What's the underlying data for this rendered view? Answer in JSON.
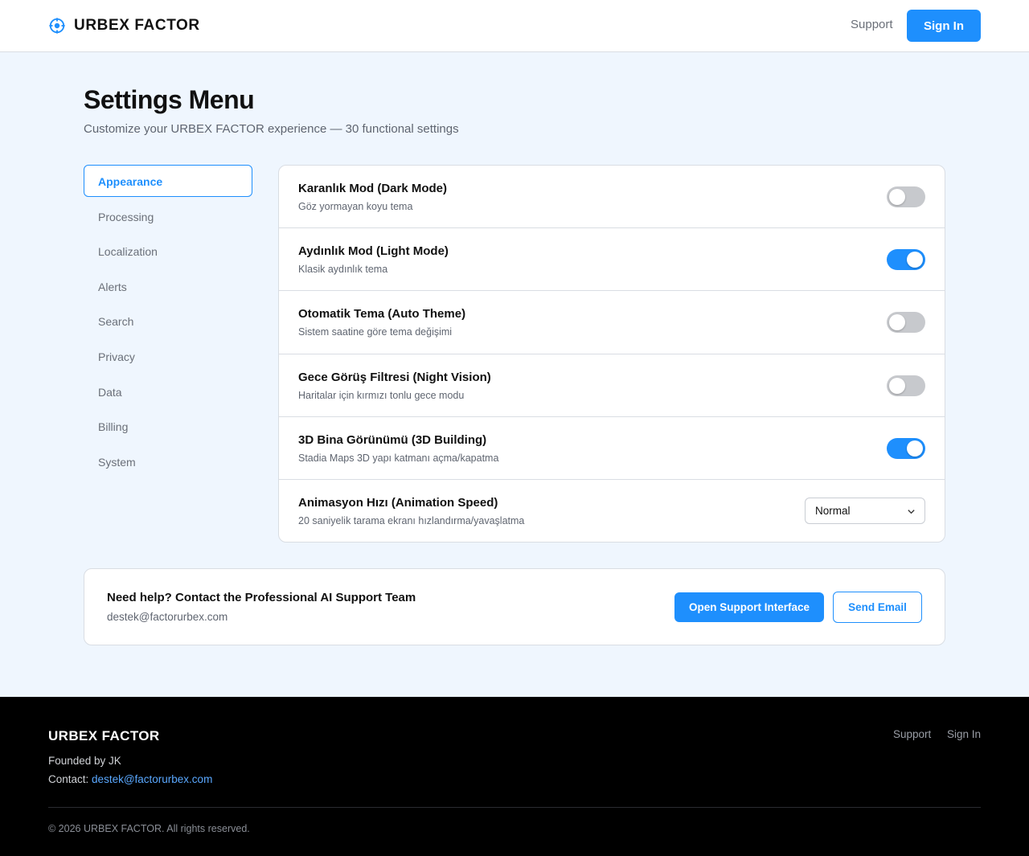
{
  "header": {
    "brand": "URBEX FACTOR",
    "brand_icon": "crosshair-icon",
    "support_link": "Support",
    "signin_label": "Sign In",
    "accent_color": "#1e8ffd"
  },
  "page": {
    "title": "Settings Menu",
    "subtitle": "Customize your URBEX FACTOR experience — 30 functional settings"
  },
  "sidebar": {
    "active": "Appearance",
    "items": [
      {
        "label": "Appearance"
      },
      {
        "label": "Processing"
      },
      {
        "label": "Localization"
      },
      {
        "label": "Alerts"
      },
      {
        "label": "Search"
      },
      {
        "label": "Privacy"
      },
      {
        "label": "Data"
      },
      {
        "label": "Billing"
      },
      {
        "label": "System"
      }
    ]
  },
  "settings": [
    {
      "title": "Karanlık Mod (Dark Mode)",
      "desc": "Göz yormayan koyu tema",
      "control": "toggle",
      "on": false
    },
    {
      "title": "Aydınlık Mod (Light Mode)",
      "desc": "Klasik aydınlık tema",
      "control": "toggle",
      "on": true
    },
    {
      "title": "Otomatik Tema (Auto Theme)",
      "desc": "Sistem saatine göre tema değişimi",
      "control": "toggle",
      "on": false
    },
    {
      "title": "Gece Görüş Filtresi (Night Vision)",
      "desc": "Haritalar için kırmızı tonlu gece modu",
      "control": "toggle",
      "on": false
    },
    {
      "title": "3D Bina Görünümü (3D Building)",
      "desc": "Stadia Maps 3D yapı katmanı açma/kapatma",
      "control": "toggle",
      "on": true
    },
    {
      "title": "Animasyon Hızı (Animation Speed)",
      "desc": "20 saniyelik tarama ekranı hızlandırma/yavaşlatma",
      "control": "select",
      "value": "Normal"
    }
  ],
  "help": {
    "title": "Need help? Contact the Professional AI Support Team",
    "email": "destek@factorurbex.com",
    "support_button": "Open Support Interface",
    "email_button": "Send Email"
  },
  "footer": {
    "brand": "URBEX FACTOR",
    "founded": "Founded by JK",
    "contact_label": "Contact:",
    "contact_email": "destek@factorurbex.com",
    "links": [
      "Support",
      "Sign In"
    ],
    "copyright": "© 2026 URBEX FACTOR. All rights reserved."
  }
}
